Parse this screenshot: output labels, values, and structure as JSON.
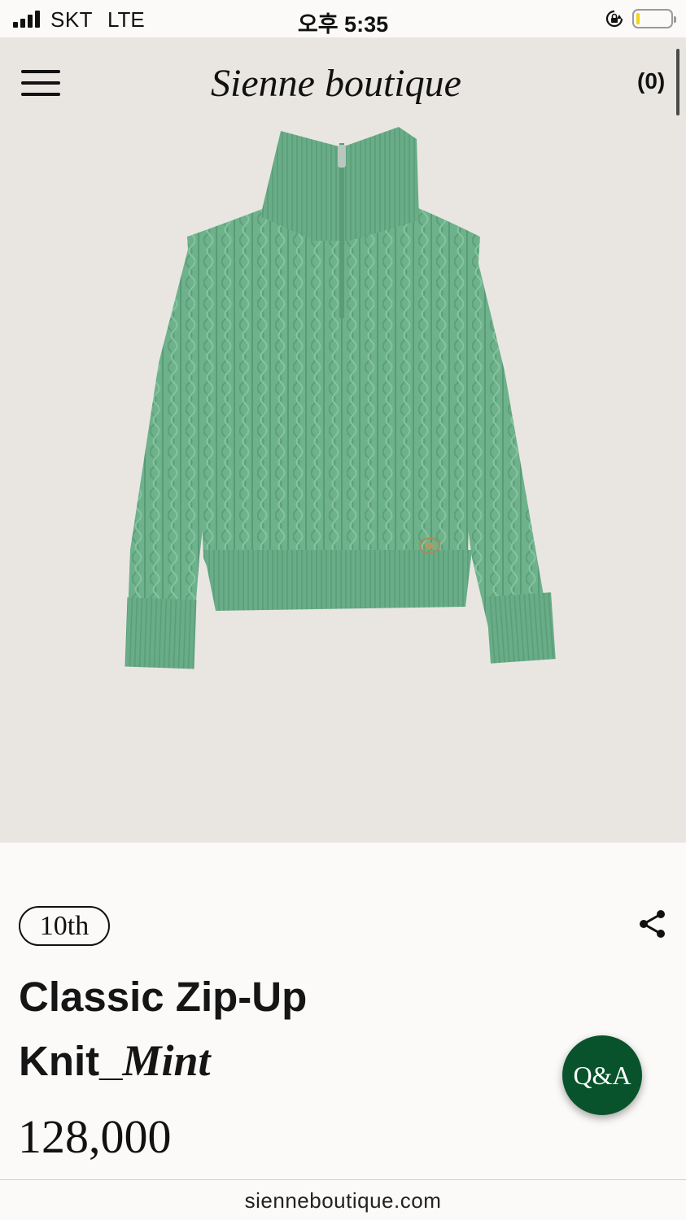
{
  "status_bar": {
    "carrier": "SKT",
    "network": "LTE",
    "time": "오후 5:35",
    "battery_level": 0.1,
    "battery_color": "#f3d21b"
  },
  "header": {
    "logo_text": "Sienne boutique",
    "cart_count": "(0)",
    "menu_icon": "hamburger-menu-icon"
  },
  "product": {
    "image_alt": "mint cable-knit half-zip sweater",
    "image_color": "#6fb38d",
    "badge": "10th",
    "title_line1": "Classic Zip-Up",
    "title_line2_prefix": "Knit_",
    "title_line2_italic": "Mint",
    "price": "128,000",
    "share_icon": "share-icon"
  },
  "qa_button": {
    "label": "Q&A",
    "color": "#08532c"
  },
  "url_bar": {
    "url": "sienneboutique.com"
  }
}
